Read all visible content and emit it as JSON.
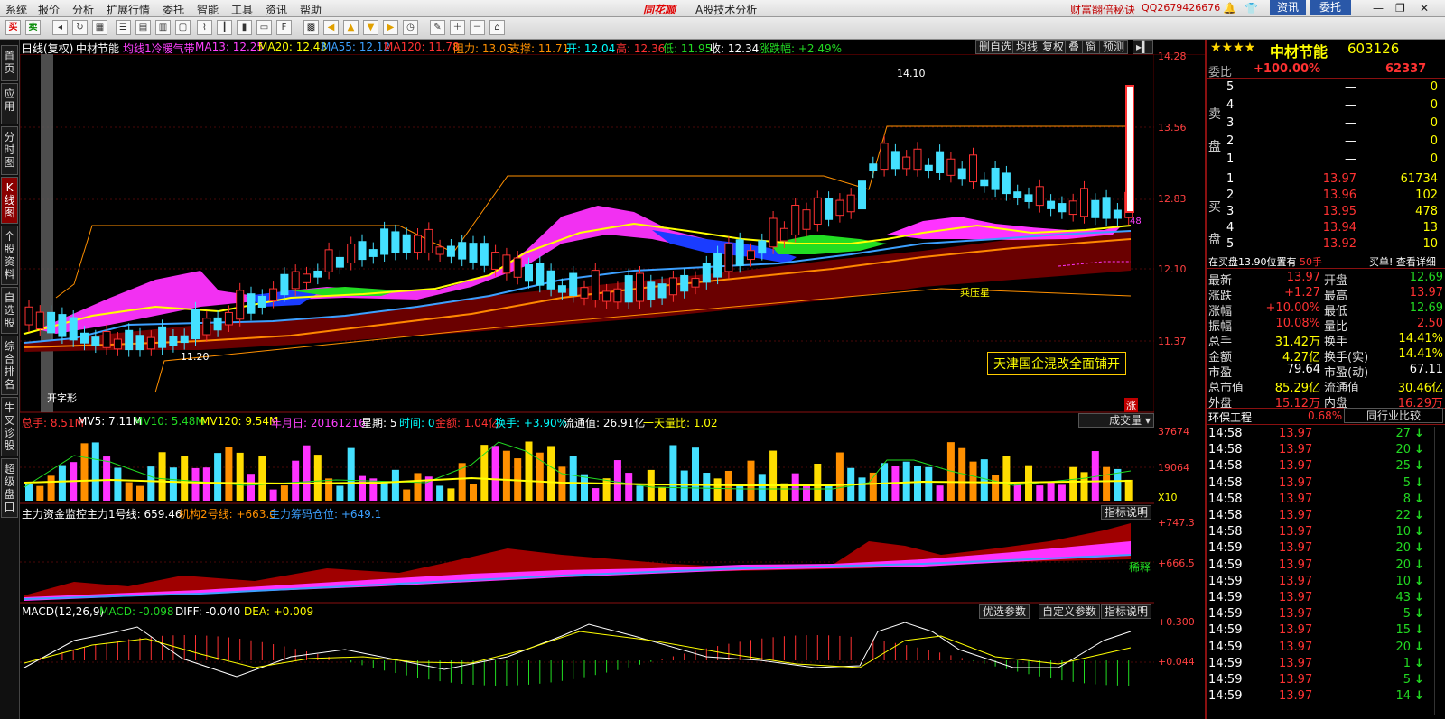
{
  "menu": [
    "系统",
    "报价",
    "分析",
    "扩展行情",
    "委托",
    "智能",
    "工具",
    "资讯",
    "帮助"
  ],
  "brand": "同花顺",
  "window_title": "A股技术分析",
  "top_right": {
    "promo": "财富翻倍秘诀",
    "qq": "QQ2679426676",
    "btn_info": "资讯",
    "btn_trade": "委托"
  },
  "toolbar_labels": [
    "买",
    "卖"
  ],
  "left_nav": [
    {
      "label": "首页"
    },
    {
      "label": "应用"
    },
    {
      "label": "分时图"
    },
    {
      "label": "K线图"
    },
    {
      "label": "个股资料"
    },
    {
      "label": "自选股"
    },
    {
      "label": "综合排名"
    },
    {
      "label": "牛叉诊股"
    },
    {
      "label": "超级盘口"
    }
  ],
  "kline_header": {
    "period": "日线(复权)",
    "name": "中材节能",
    "indicator": "均线1冷暖气带",
    "ma13": "MA13: 12.25",
    "ma20": "MA20: 12.43",
    "ma55": "MA55: 12.12",
    "ma120": "MA120: 11.78",
    "resist": "阻力: 13.05",
    "support": "支撑: 11.71",
    "open": "开: 12.04",
    "high": "高: 12.36",
    "low": "低: 11.95",
    "close": "收: 12.34",
    "change": "涨跌幅: +2.49%"
  },
  "kline_buttons": [
    "删自选",
    "均线",
    "复权",
    "叠",
    "窗",
    "预测"
  ],
  "price_axis": [
    "14.28",
    "13.56",
    "12.83",
    "12.10",
    "11.37"
  ],
  "annotations": {
    "high": "14.10",
    "low": "11.20",
    "pattern": "开字形",
    "pattern2": "乘压星",
    "news": "天津国企混改全面铺开",
    "rise": "涨",
    "value48": "48"
  },
  "volume_header": {
    "total": "总手: 8.51M",
    "mv5": "MV5: 7.11M",
    "mv10": "MV10: 5.48M",
    "mv120": "MV120: 9.54M",
    "date": "年月日: 20161216",
    "week": "星期: 5",
    "time": "时间: 0",
    "amount": "金额: 1.04亿",
    "turnover": "换手: +3.90%",
    "float": "流通值: 26.91亿",
    "ratio": "一天量比: 1.02",
    "select": "成交量"
  },
  "volume_axis": [
    "37674",
    "19064",
    "X10"
  ],
  "fund_header": {
    "title": "主力资金监控",
    "l1": "主力1号线: 659.46",
    "l2": "机构2号线: +663.0",
    "l3": "主力筹码仓位: +649.1",
    "btn": "指标说明"
  },
  "fund_axis": [
    "+747.3",
    "+666.5"
  ],
  "fund_label": "稀释",
  "macd_header": {
    "title": "MACD(12,26,9)",
    "macd": "MACD: -0.098",
    "diff": "DIFF: -0.040",
    "dea": "DEA: +0.009",
    "btns": [
      "优选参数",
      "自定义参数",
      "指标说明"
    ]
  },
  "macd_axis": [
    "+0.300",
    "+0.044"
  ],
  "quote": {
    "stars": "★★★★",
    "name": "中材节能",
    "code": "603126",
    "wb_label": "委比",
    "wb": "+100.00%",
    "wb_val": "62337",
    "sell_label": "卖盘",
    "buy_label": "买盘",
    "sells": [
      [
        "5",
        "—",
        "0"
      ],
      [
        "4",
        "—",
        "0"
      ],
      [
        "3",
        "—",
        "0"
      ],
      [
        "2",
        "—",
        "0"
      ],
      [
        "1",
        "—",
        "0"
      ]
    ],
    "buys": [
      [
        "1",
        "13.97",
        "61734"
      ],
      [
        "2",
        "13.96",
        "102"
      ],
      [
        "3",
        "13.95",
        "478"
      ],
      [
        "4",
        "13.94",
        "13"
      ],
      [
        "5",
        "13.92",
        "10"
      ]
    ],
    "queue": "在买盘13.90位置有",
    "queue_hands": "50手",
    "queue_link": "买单! 查看详细",
    "stats": [
      [
        "最新",
        "13.97",
        "开盘",
        "12.69"
      ],
      [
        "涨跌",
        "+1.27",
        "最高",
        "13.97"
      ],
      [
        "涨幅",
        "+10.00%",
        "最低",
        "12.69"
      ],
      [
        "振幅",
        "10.08%",
        "量比",
        "2.50"
      ],
      [
        "总手",
        "31.42万",
        "换手",
        "14.41%"
      ],
      [
        "金额",
        "4.27亿",
        "换手(实)",
        "14.41%"
      ],
      [
        "市盈",
        "79.64",
        "市盈(动)",
        "67.11"
      ],
      [
        "总市值",
        "85.29亿",
        "流通值",
        "30.46亿"
      ],
      [
        "外盘",
        "15.12万",
        "内盘",
        "16.29万"
      ]
    ],
    "industry": "环保工程",
    "industry_chg": "0.68%",
    "industry_btn": "同行业比较",
    "ticks": [
      [
        "14:58",
        "13.97",
        "27"
      ],
      [
        "14:58",
        "13.97",
        "20"
      ],
      [
        "14:58",
        "13.97",
        "25"
      ],
      [
        "14:58",
        "13.97",
        "5"
      ],
      [
        "14:58",
        "13.97",
        "8"
      ],
      [
        "14:58",
        "13.97",
        "22"
      ],
      [
        "14:58",
        "13.97",
        "10"
      ],
      [
        "14:59",
        "13.97",
        "20"
      ],
      [
        "14:59",
        "13.97",
        "20"
      ],
      [
        "14:59",
        "13.97",
        "10"
      ],
      [
        "14:59",
        "13.97",
        "43"
      ],
      [
        "14:59",
        "13.97",
        "5"
      ],
      [
        "14:59",
        "13.97",
        "15"
      ],
      [
        "14:59",
        "13.97",
        "20"
      ],
      [
        "14:59",
        "13.97",
        "1"
      ],
      [
        "14:59",
        "13.97",
        "5"
      ],
      [
        "14:59",
        "13.97",
        "14"
      ]
    ]
  }
}
